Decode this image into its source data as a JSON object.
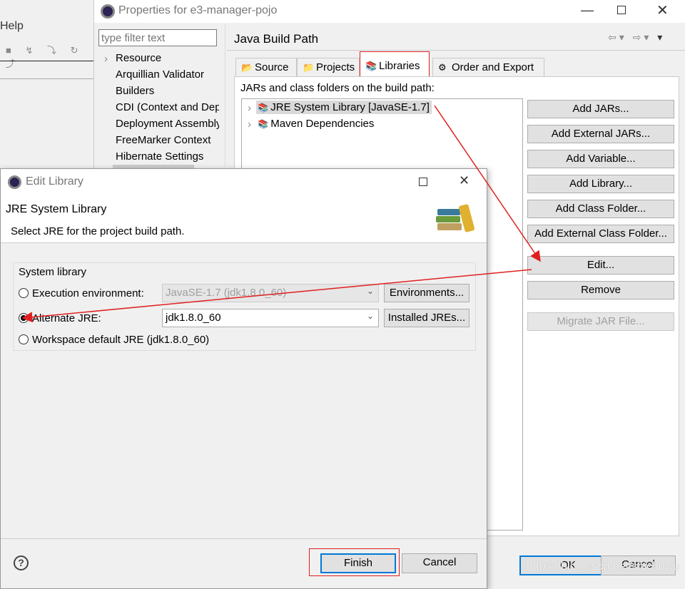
{
  "ide": {
    "menu_help": "Help"
  },
  "properties": {
    "title": "Properties for e3-manager-pojo",
    "filter_placeholder": "type filter text",
    "tree": [
      "Resource",
      "Arquillian Validator",
      "Builders",
      "CDI (Context and Dependency Injection)",
      "Deployment Assembly",
      "FreeMarker Context",
      "Hibernate Settings"
    ],
    "heading": "Java Build Path",
    "tabs": [
      "Source",
      "Projects",
      "Libraries",
      "Order and Export"
    ],
    "selected_tab": "Libraries",
    "list_label": "JARs and class folders on the build path:",
    "libraries": [
      "JRE System Library [JavaSE-1.7]",
      "Maven Dependencies"
    ],
    "buttons": [
      "Add JARs...",
      "Add External JARs...",
      "Add Variable...",
      "Add Library...",
      "Add Class Folder...",
      "Add External Class Folder...",
      "Edit...",
      "Remove",
      "Migrate JAR File..."
    ],
    "ok": "OK",
    "cancel": "Cancel"
  },
  "edit_library": {
    "title": "Edit Library",
    "header_title": "JRE System Library",
    "header_desc": "Select JRE for the project build path.",
    "group_label": "System library",
    "exec_env_label": "Execution environment:",
    "exec_env_value": "JavaSE-1.7 (jdk1.8.0_60)",
    "environments_button": "Environments...",
    "alt_jre_label": "Alternate JRE:",
    "alt_jre_value": "jdk1.8.0_60",
    "installed_jres_button": "Installed JREs...",
    "workspace_label": "Workspace default JRE (jdk1.8.0_60)",
    "selected_option": "Alternate JRE",
    "finish": "Finish",
    "cancel": "Cancel"
  },
  "watermark": "https://blog.csdn.net/shichuwu",
  "colors": {
    "annotation": "#e02020",
    "focus": "#0078d7"
  }
}
